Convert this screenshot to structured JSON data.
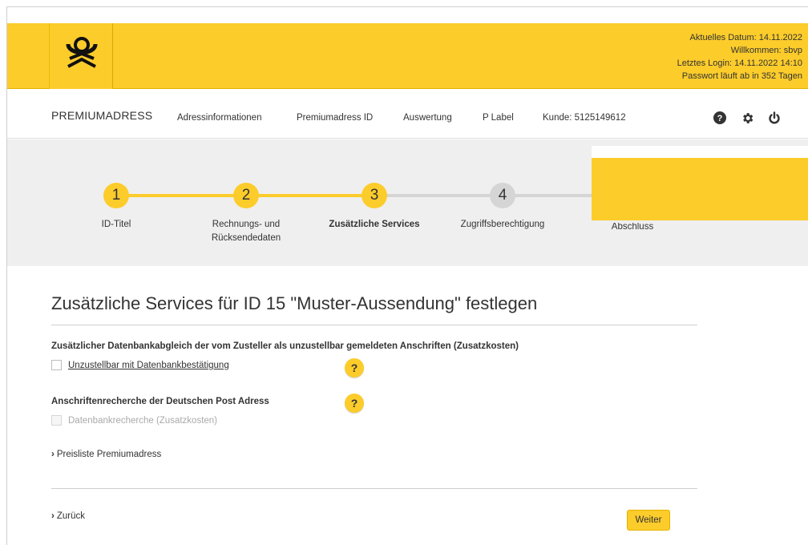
{
  "header": {
    "current_date": "Aktuelles Datum: 14.11.2022",
    "welcome": "Willkommen: sbvp",
    "last_login": "Letztes Login: 14.11.2022 14:10",
    "password_expiry": "Passwort läuft ab in 352 Tagen"
  },
  "nav": {
    "brand": "PREMIUMADRESS",
    "links": [
      "Adressinformationen",
      "Premiumadress ID",
      "Auswertung",
      "P Label",
      "Kunde: 5125149612"
    ],
    "icons": [
      "help-icon",
      "gear-icon",
      "power-icon"
    ]
  },
  "steps": [
    {
      "number": "1",
      "label": "ID-Titel",
      "label2": "",
      "state": "done"
    },
    {
      "number": "2",
      "label": "Rechnungs- und",
      "label2": "Rücksendedaten",
      "state": "done"
    },
    {
      "number": "3",
      "label": "Zusätzliche Services",
      "label2": "",
      "state": "active"
    },
    {
      "number": "4",
      "label": "Zugriffsberechtigung",
      "label2": "",
      "state": "todo"
    },
    {
      "number": "",
      "label": "Abschluss",
      "label2": "",
      "state": "todo"
    }
  ],
  "main": {
    "title": "Zusätzliche Services für ID 15 \"Muster-Aussendung\" festlegen",
    "section1_head": "Zusätzlicher Datenbankabgleich der vom Zusteller als unzustellbar gemeldeten Anschriften (Zusatzkosten)",
    "section1_option": "Unzustellbar mit Datenbankbestätigung",
    "section2_head": "Anschriftenrecherche der Deutschen Post Adress",
    "section2_option": "Datenbankrecherche (Zusatzkosten)",
    "help_label": "?",
    "price_link": "Preisliste Premiumadress",
    "back_link": "Zurück",
    "next_button": "Weiter"
  },
  "colors": {
    "brand_yellow": "#fccc2b",
    "step_inactive": "#d5d5d5",
    "band_gray": "#efefef"
  }
}
